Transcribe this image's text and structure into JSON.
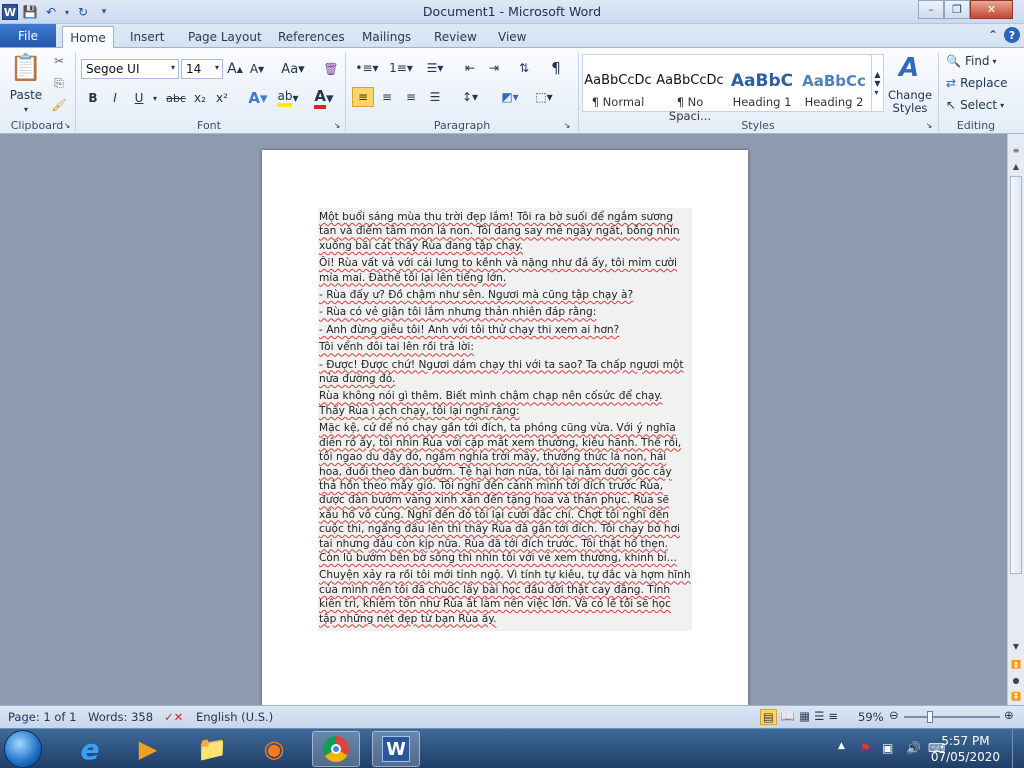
{
  "window": {
    "title": "Document1  -  Microsoft Word"
  },
  "qat": {
    "app_icon": "W"
  },
  "tabs": {
    "file": "File",
    "items": [
      "Home",
      "Insert",
      "Page Layout",
      "References",
      "Mailings",
      "Review",
      "View"
    ]
  },
  "ribbon": {
    "clipboard": {
      "label": "Clipboard",
      "paste": "Paste"
    },
    "font": {
      "label": "Font",
      "family": "Segoe UI",
      "size": "14",
      "bold": "B",
      "italic": "I",
      "underline": "U",
      "strike": "abc",
      "sub": "x₂",
      "sup": "x²",
      "grow": "A",
      "shrink": "A",
      "case": "Aa"
    },
    "paragraph": {
      "label": "Paragraph"
    },
    "styles": {
      "label": "Styles",
      "items": [
        {
          "preview": "AaBbCcDc",
          "name": "¶ Normal"
        },
        {
          "preview": "AaBbCcDc",
          "name": "¶ No Spaci..."
        },
        {
          "preview": "AaBbC",
          "name": "Heading 1"
        },
        {
          "preview": "AaBbCc",
          "name": "Heading 2"
        }
      ],
      "change": "Change Styles"
    },
    "editing": {
      "label": "Editing",
      "find": "Find",
      "replace": "Replace",
      "select": "Select"
    }
  },
  "document": {
    "paragraphs": [
      "Một buổi sáng mùa thu trời đẹp lắm! Tôi ra bờ suối để ngắm sương tan và điểm tâm món lá non. Tôi đang say mê ngây ngất, bỗng nhìn xuống bãi cát thấy Rùa đang tập chạy.",
      "Ôi! Rùa vất vả với cái lưng to kềnh và nặng như đá ấy, tôi mỉm cười mỉa mai. Đàthế tôi lại lên tiếng lớn.",
      "- Rùa đấy ư? Đồ chậm như sên. Ngươi mà cũng tập chạy à?",
      "- Rùa có vẻ giận tôi lắm nhưng thản nhiên đáp rằng:",
      "- Anh đừng giễu tôi! Anh với tôi thử chạy thi xem ai hơn?",
      "Tôi vểnh đôi tai lên rồi trả lời:",
      "- Được! Được chứ! Ngươi dám chạy thi với ta sao? Ta chấp ngươi một nửa đường đó.",
      "Rùa không nói gì thêm. Biết mình chậm chạp nên cốsức để chạy. Thấy Rùa ì ạch chạy,  tôi lại nghĩ rằng:",
      "Mặc kệ, cứ để nó chạy gần tới đích, ta phóng cũng vừa. Với ý nghĩa điên rồ ấy, tôi nhìn Rùa với cặp mắt xem thường, kiêu hãnh. Thế rồi, tôi ngao du đây đó, ngắm nghía trời mây, thưởng thức lá non,  hái hoa, đuổi theo đàn bướm. Tệ hại hơn nữa, tôi lại nằm dưới gốc cây thả hồn theo mây gió. Tôi nghĩ đến cảnh mình tới đích trước Rùa, được đàn bướm vàng xinh xắn đến tặng hoa và thán phục. Rùa sẽ xấu hổ vô cùng. Nghĩ đến đó tôi lại cười đắc chí. Chợt tôi nghĩ đến cuộc thi, ngẩng đầu lên thì thấy Rùa đã gần tới đích. Tôi chạy bở hơi tai nhưng đâu còn kịp nữa. Rùa đã tới đích trước. Tôi thật hổ thẹn. Còn lũ bướm bên bờ sông thì nhìn tôi với vẻ xem thường, khinh bỉ...",
      "Chuyện xảy ra rồi tôi mới tỉnh ngộ. Vì tính tự kiêu, tự đắc và hợm hĩnh của mình nên tôi đã chuốc lấy bài học đầu đời thật cay đắng. Tính kiên trì, khiêm tốn như Rùa ắt làm nên việc lớn. Và có lẽ tôi sẽ học tập những nét đẹp từ bạn Rùa ấy."
    ]
  },
  "status": {
    "page": "Page: 1 of 1",
    "words": "Words: 358",
    "language": "English (U.S.)",
    "zoom": "59%",
    "zoom_level": 0.59
  },
  "taskbar": {
    "time": "5:57 PM",
    "date": "07/05/2020"
  },
  "colors": {
    "accent": "#2b579a",
    "file_tab": "#2457a8"
  }
}
